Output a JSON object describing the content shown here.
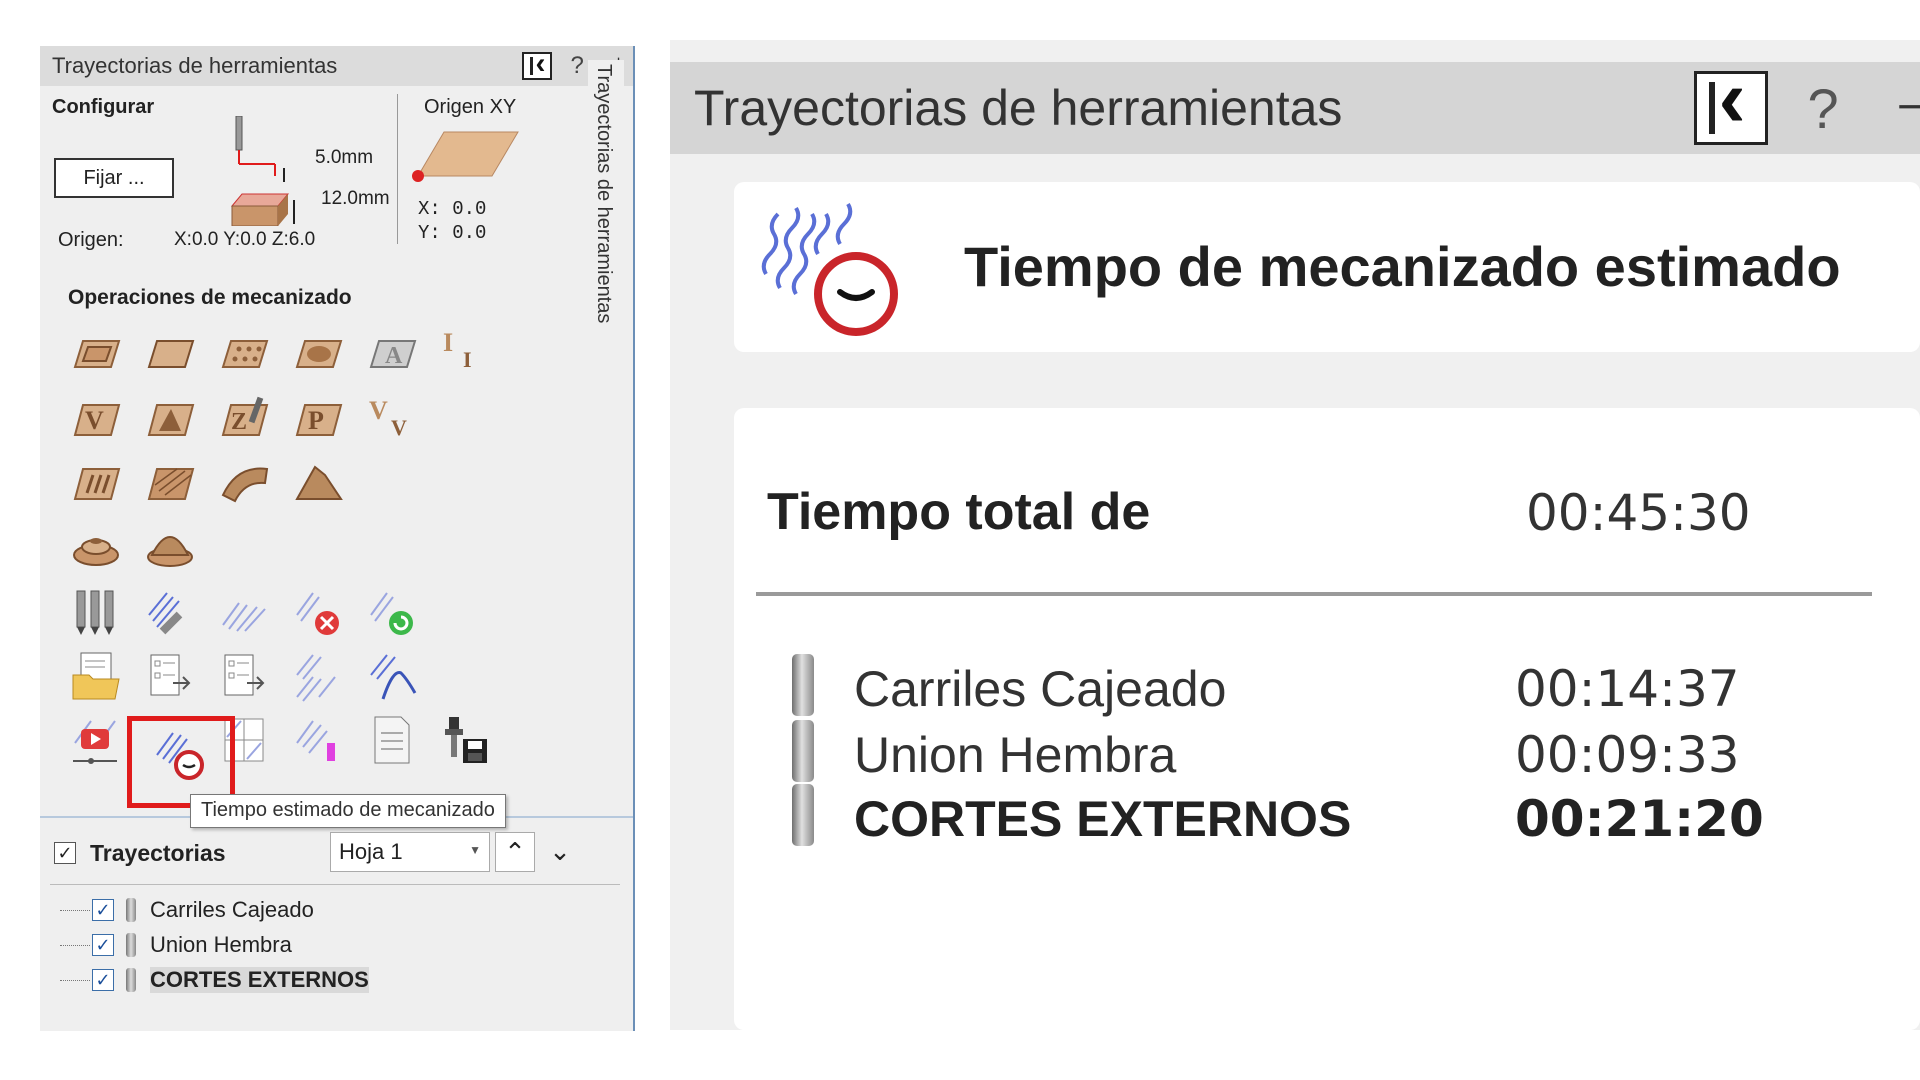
{
  "left_panel": {
    "title": "Trayectorias de herramientas",
    "title_buttons": {
      "help": "?",
      "pin": "⊣"
    },
    "config": {
      "heading": "Configurar",
      "fix_button": "Fijar ...",
      "origin_label": "Origen:",
      "origin_coords": "X:0.0 Y:0.0 Z:6.0",
      "depth_top": "5.0mm",
      "depth_material": "12.0mm",
      "xy_origin_title": "Origen XY",
      "xy_x": "X: 0.0",
      "xy_y": "Y: 0.0"
    },
    "operations_heading": "Operaciones de mecanizado",
    "operations": [
      {
        "icon": "profile-toolpath-icon"
      },
      {
        "icon": "pocket-toolpath-icon"
      },
      {
        "icon": "drilling-toolpath-icon"
      },
      {
        "icon": "quick-engrave-icon"
      },
      {
        "icon": "texture-toolpath-icon"
      },
      {
        "icon": "inlay-toolpath-icon"
      },
      {
        "icon": "vcarve-toolpath-icon"
      },
      {
        "icon": "prism-carve-icon"
      },
      {
        "icon": "chamfer-toolpath-icon"
      },
      {
        "icon": "moulding-toolpath-icon"
      },
      {
        "icon": "vcarve-inlay-icon"
      },
      {
        "icon": "fluting-toolpath-icon"
      },
      {
        "icon": "raster-toolpath-icon"
      },
      {
        "icon": "roughing-toolpath-icon"
      },
      {
        "icon": "finishing-toolpath-icon"
      },
      {
        "icon": "profiling-3d-icon"
      },
      {
        "icon": "dome-toolpath-icon"
      }
    ],
    "utilities": [
      {
        "icon": "tool-database-icon"
      },
      {
        "icon": "edit-toolpath-icon"
      },
      {
        "icon": "preview-toolpath-icon"
      },
      {
        "icon": "delete-toolpath-icon"
      },
      {
        "icon": "recalculate-toolpath-icon"
      },
      {
        "icon": "open-template-icon"
      },
      {
        "icon": "save-template-icon"
      },
      {
        "icon": "merge-template-icon"
      },
      {
        "icon": "merge-toolpaths-icon"
      },
      {
        "icon": "toolpath-summary-icon"
      },
      {
        "icon": "simulation-video-icon"
      },
      {
        "icon": "machining-time-icon"
      },
      {
        "icon": "nested-toolpath-icon"
      },
      {
        "icon": "visible-toolpaths-icon"
      },
      {
        "icon": "toolpath-report-icon"
      },
      {
        "icon": "save-toolpath-icon"
      }
    ],
    "tooltip": "Tiempo estimado de mecanizado",
    "toolpaths_section": {
      "label": "Trayectorias",
      "checked": true,
      "sheet": "Hoja 1"
    },
    "toolpaths": [
      {
        "name": "Carriles Cajeado",
        "checked": true,
        "selected": false
      },
      {
        "name": "Union Hembra",
        "checked": true,
        "selected": false
      },
      {
        "name": "CORTES EXTERNOS",
        "checked": true,
        "selected": true
      }
    ],
    "vertical_tab": "Trayectorias de herramientas"
  },
  "right_panel": {
    "title": "Trayectorias de herramientas",
    "help": "?",
    "pin": "⊣",
    "estimate_heading": "Tiempo de mecanizado estimado",
    "total_label": "Tiempo total de",
    "total_value": "00:45:30",
    "rows": [
      {
        "name": "Carriles Cajeado",
        "time": "00:14:37",
        "bold": false
      },
      {
        "name": "Union Hembra",
        "time": "00:09:33",
        "bold": false
      },
      {
        "name": "CORTES EXTERNOS",
        "time": "00:21:20",
        "bold": true
      }
    ]
  },
  "colors": {
    "highlight": "#e01b1b",
    "wood": "#c9956a",
    "clock_red": "#c9252a",
    "toolpath_blue": "#5a6fd6"
  }
}
